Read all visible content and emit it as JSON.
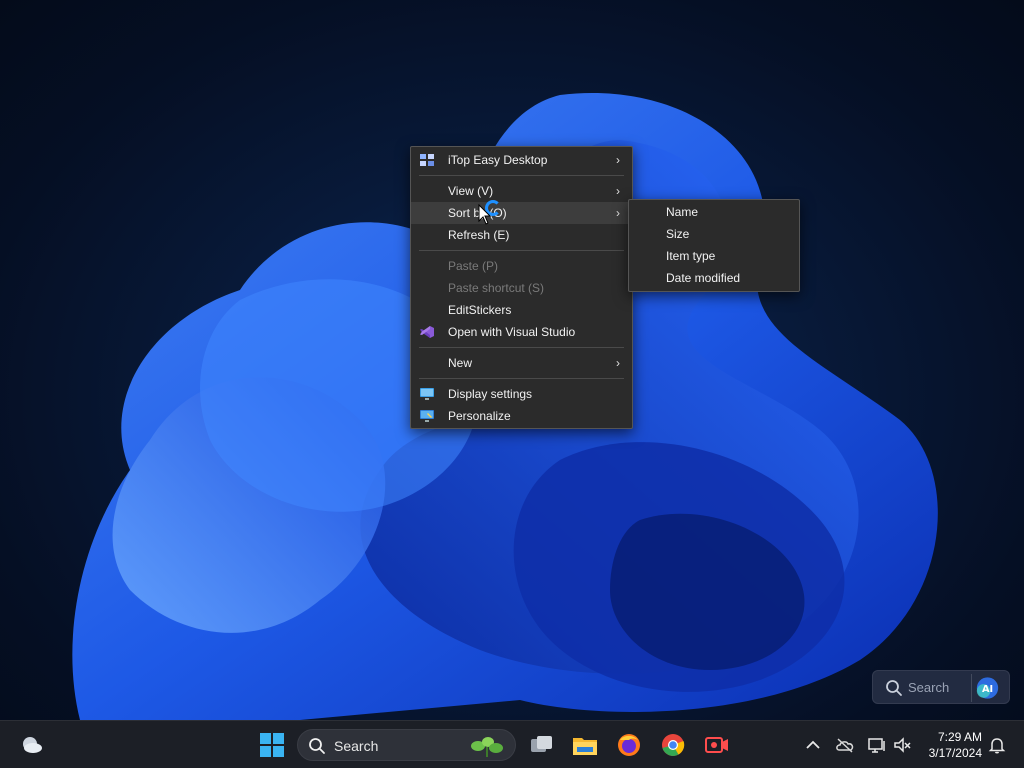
{
  "context_menu": {
    "items": [
      {
        "label": "iTop Easy Desktop",
        "submenu": true
      },
      {
        "label": "View (V)",
        "submenu": true
      },
      {
        "label": "Sort by (O)",
        "submenu": true
      },
      {
        "label": "Refresh (E)"
      },
      {
        "label": "Paste (P)",
        "disabled": true
      },
      {
        "label": "Paste shortcut (S)",
        "disabled": true
      },
      {
        "label": "EditStickers"
      },
      {
        "label": "Open with Visual Studio"
      },
      {
        "label": "New",
        "submenu": true
      },
      {
        "label": "Display settings"
      },
      {
        "label": "Personalize"
      }
    ]
  },
  "sort_submenu": {
    "items": [
      "Name",
      "Size",
      "Item type",
      "Date modified"
    ]
  },
  "desktop_search": {
    "placeholder": "Search",
    "ai_label": "AI"
  },
  "taskbar": {
    "search_label": "Search",
    "clock_time": "7:29 AM",
    "clock_date": "3/17/2024"
  },
  "colors": {
    "accent": "#1e6fff",
    "menu_bg": "#2b2b2b",
    "taskbar_bg": "#1c1f26"
  }
}
